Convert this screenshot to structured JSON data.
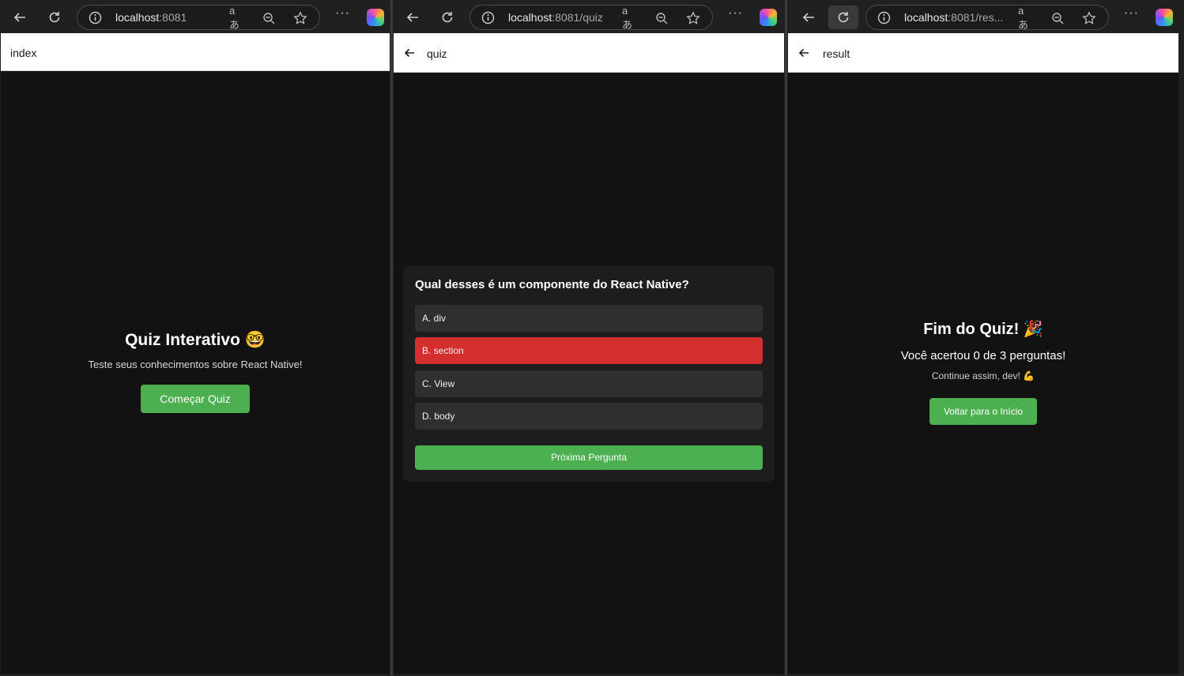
{
  "windows": [
    {
      "url_host": "localhost",
      "url_rest": ":8081",
      "header_title": "index"
    },
    {
      "url_host": "localhost",
      "url_rest": ":8081/quiz",
      "header_title": "quiz"
    },
    {
      "url_host": "localhost",
      "url_rest": ":8081/res...",
      "header_title": "result"
    }
  ],
  "browser": {
    "read_aloud_label": "aあ",
    "more_label": "···"
  },
  "index_screen": {
    "title": "Quiz Interativo",
    "title_emoji": "🤓",
    "subtitle": "Teste seus conhecimentos sobre React Native!",
    "start_button": "Começar Quiz"
  },
  "quiz_screen": {
    "question": "Qual desses é um componente do React Native?",
    "options": [
      "A. div",
      "B. section",
      "C. View",
      "D. body"
    ],
    "selected_option": "B. section",
    "next_button": "Próxima Pergunta"
  },
  "result_screen": {
    "title": "Fim do Quiz!",
    "title_emoji": "🎉",
    "score_text": "Você acertou 0 de 3 perguntas!",
    "encouragement": "Continue assim, dev! 💪",
    "home_button": "Voltar para o Início"
  },
  "colors": {
    "accent_green": "#4caf50",
    "selected_red": "#d32f2f",
    "page_bg": "#121212",
    "card_bg": "#1d1d1d",
    "option_bg": "#2f2f2f"
  }
}
